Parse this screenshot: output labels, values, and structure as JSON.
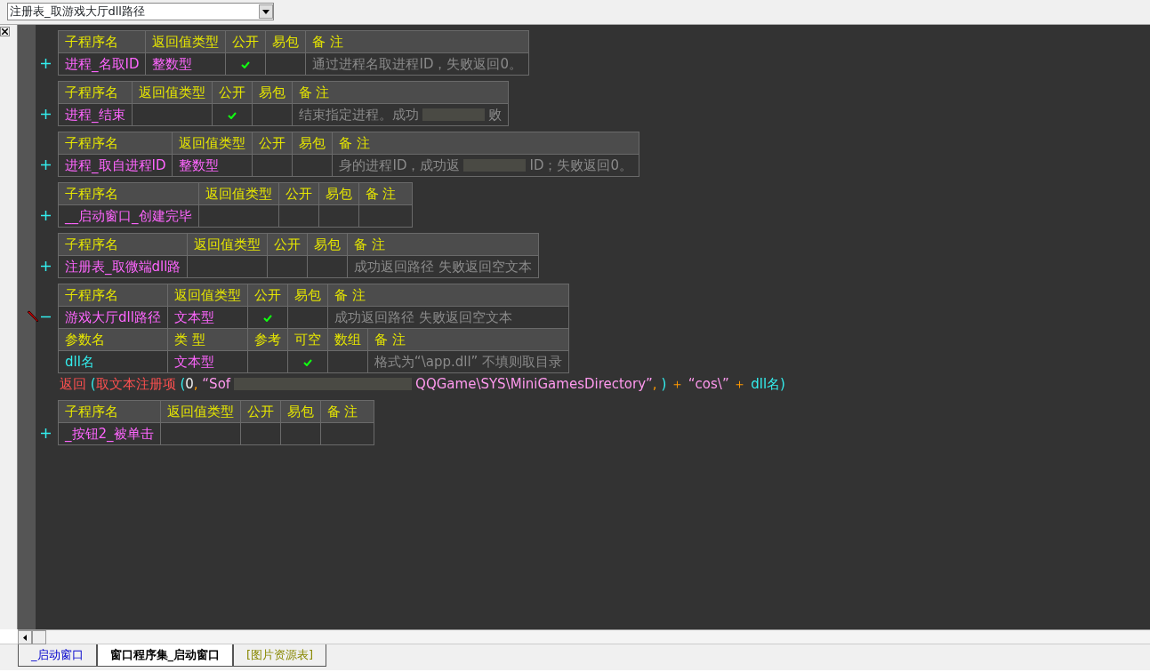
{
  "dropdown": {
    "value": "注册表_取游戏大厅dll路径"
  },
  "subprograms": [
    {
      "expanded": false,
      "headers": [
        "子程序名",
        "返回值类型",
        "公开",
        "易包",
        "备 注"
      ],
      "name": "进程_名取ID",
      "return_type": "整数型",
      "public": true,
      "epkg": false,
      "remark": "通过进程名取进程ID，失败返回0。"
    },
    {
      "expanded": false,
      "headers": [
        "子程序名",
        "返回值类型",
        "公开",
        "易包",
        "备 注"
      ],
      "name": "进程_结束",
      "public": true,
      "epkg": false,
      "remark": "结束指定进程。成功",
      "remark_tail": "败"
    },
    {
      "expanded": false,
      "headers": [
        "子程序名",
        "返回值类型",
        "公开",
        "易包",
        "备 注"
      ],
      "name": "进程_取自进程ID",
      "return_type": "整数型",
      "public": false,
      "epkg": false,
      "remark": "身的进程ID，成功返",
      "remark_tail": "ID；失败返回0。"
    },
    {
      "expanded": false,
      "headers": [
        "子程序名",
        "返回值类型",
        "公开",
        "易包",
        "备 注"
      ],
      "name": "__启动窗口_创建完毕",
      "public": false,
      "epkg": false
    },
    {
      "expanded": false,
      "headers": [
        "子程序名",
        "返回值类型",
        "公开",
        "易包",
        "备 注"
      ],
      "name": "注册表_取微端dll路",
      "public": false,
      "epkg": false,
      "remark": "成功返回路径 失败返回空文本"
    },
    {
      "expanded": true,
      "headers": [
        "子程序名",
        "返回值类型",
        "公开",
        "易包",
        "备 注"
      ],
      "name": "游戏大厅dll路径",
      "return_type": "文本型",
      "public": true,
      "epkg": false,
      "remark": "成功返回路径 失败返回空文本",
      "param_headers": [
        "参数名",
        "类 型",
        "参考",
        "可空",
        "数组",
        "备 注"
      ],
      "params": [
        {
          "name": "dll名",
          "type": "文本型",
          "ref": false,
          "nullable": true,
          "array": false,
          "remark": "格式为“\\app.dll” 不填则取目录"
        }
      ],
      "code": [
        {
          "kind": "keyword",
          "text": "返回"
        },
        {
          "kind": "paren",
          "text": " ("
        },
        {
          "kind": "keyword",
          "text": "取文本注册项"
        },
        {
          "kind": "paren",
          "text": " ("
        },
        {
          "kind": "number",
          "text": "0"
        },
        {
          "kind": "op",
          "text": ", "
        },
        {
          "kind": "string",
          "text": "“Sof"
        },
        {
          "kind": "gap"
        },
        {
          "kind": "string",
          "text": "QQGame\\SYS\\MiniGamesDirectory”"
        },
        {
          "kind": "op",
          "text": ", "
        },
        {
          "kind": "paren",
          "text": ")"
        },
        {
          "kind": "op",
          "text": " ＋ "
        },
        {
          "kind": "string",
          "text": "“cos\\”"
        },
        {
          "kind": "op",
          "text": " ＋ "
        },
        {
          "kind": "var",
          "text": "dll名"
        },
        {
          "kind": "paren",
          "text": ")"
        }
      ]
    },
    {
      "expanded": false,
      "headers": [
        "子程序名",
        "返回值类型",
        "公开",
        "易包",
        "备 注"
      ],
      "name": "_按钮2_被单击",
      "public": false,
      "epkg": false
    }
  ],
  "tabs": [
    {
      "label": "_启动窗口",
      "selected": false,
      "kind": "window"
    },
    {
      "label": "窗口程序集_启动窗口",
      "selected": true,
      "kind": "class"
    },
    {
      "label": "[图片资源表]",
      "selected": false,
      "kind": "resource"
    }
  ]
}
